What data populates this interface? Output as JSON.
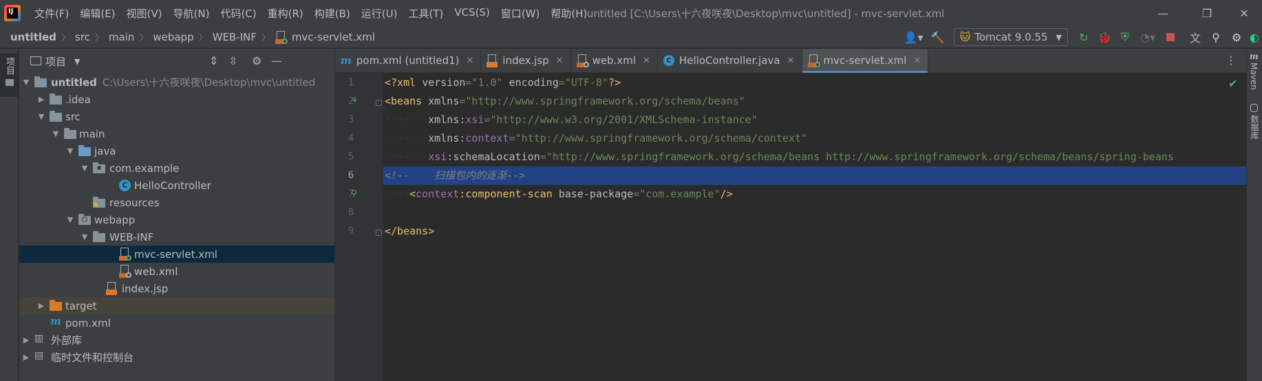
{
  "window": {
    "title": "untitled [C:\\Users\\十六夜咲夜\\Desktop\\mvc\\untitled] - mvc-servlet.xml",
    "minimize": "—",
    "restore": "❐",
    "close": "✕"
  },
  "menu": [
    "文件(F)",
    "编辑(E)",
    "视图(V)",
    "导航(N)",
    "代码(C)",
    "重构(R)",
    "构建(B)",
    "运行(U)",
    "工具(T)",
    "VCS(S)",
    "窗口(W)",
    "帮助(H)"
  ],
  "breadcrumb": [
    "untitled",
    "src",
    "main",
    "webapp",
    "WEB-INF",
    "mvc-servlet.xml"
  ],
  "toolbar": {
    "run_config": "Tomcat 9.0.55"
  },
  "left_strip": {
    "project_tab": "项目"
  },
  "project_panel": {
    "title": "项目",
    "tree": [
      {
        "label": "untitled",
        "path": "C:\\Users\\十六夜咲夜\\Desktop\\mvc\\untitled",
        "depth": 0,
        "expanded": true,
        "icon": "module-folder-icon"
      },
      {
        "label": ".idea",
        "depth": 1,
        "expanded": false,
        "icon": "folder-icon"
      },
      {
        "label": "src",
        "depth": 1,
        "expanded": true,
        "icon": "folder-icon"
      },
      {
        "label": "main",
        "depth": 2,
        "expanded": true,
        "icon": "folder-icon"
      },
      {
        "label": "java",
        "depth": 3,
        "expanded": true,
        "icon": "source-folder-icon"
      },
      {
        "label": "com.example",
        "depth": 4,
        "expanded": true,
        "icon": "package-icon"
      },
      {
        "label": "HelloController",
        "depth": 5,
        "icon": "class-icon"
      },
      {
        "label": "resources",
        "depth": 4,
        "icon": "resources-folder-icon"
      },
      {
        "label": "webapp",
        "depth": 3,
        "expanded": true,
        "icon": "web-folder-icon"
      },
      {
        "label": "WEB-INF",
        "depth": 4,
        "expanded": true,
        "icon": "folder-icon"
      },
      {
        "label": "mvc-servlet.xml",
        "depth": 5,
        "icon": "spring-xml-icon",
        "selected": true
      },
      {
        "label": "web.xml",
        "depth": 5,
        "icon": "web-xml-icon"
      },
      {
        "label": "index.jsp",
        "depth": 4,
        "icon": "jsp-icon"
      },
      {
        "label": "target",
        "depth": 1,
        "expanded": false,
        "icon": "excluded-folder-icon",
        "excluded": true
      },
      {
        "label": "pom.xml",
        "depth": 1,
        "icon": "maven-icon"
      },
      {
        "label": "外部库",
        "depth": 0,
        "expanded": false,
        "icon": "library-icon"
      },
      {
        "label": "临时文件和控制台",
        "depth": 0,
        "expanded": false,
        "icon": "scratch-icon"
      }
    ]
  },
  "tabs": [
    {
      "label": "pom.xml (untitled1)",
      "icon": "maven-icon"
    },
    {
      "label": "index.jsp",
      "icon": "jsp-icon"
    },
    {
      "label": "web.xml",
      "icon": "web-xml-icon"
    },
    {
      "label": "HelloController.java",
      "icon": "class-icon"
    },
    {
      "label": "mvc-servlet.xml",
      "icon": "spring-xml-icon",
      "active": true
    }
  ],
  "editor": {
    "current_line": 6,
    "lines": [
      {
        "no": "1",
        "text": "<?xml version=\"1.0\" encoding=\"UTF-8\"?>"
      },
      {
        "no": "2",
        "text": "<beans xmlns=\"http://www.springframework.org/schema/beans\""
      },
      {
        "no": "3",
        "text": "       xmlns:xsi=\"http://www.w3.org/2001/XMLSchema-instance\""
      },
      {
        "no": "4",
        "text": "       xmlns:context=\"http://www.springframework.org/schema/context\""
      },
      {
        "no": "5",
        "text": "       xsi:schemaLocation=\"http://www.springframework.org/schema/beans http://www.springframework.org/schema/beans/spring-beans"
      },
      {
        "no": "6",
        "text": "<!--    扫描包内的逐渐-->"
      },
      {
        "no": "7",
        "text": "    <context:component-scan base-package=\"com.example\"/>"
      },
      {
        "no": "8",
        "text": ""
      },
      {
        "no": "9",
        "text": "</beans>"
      }
    ]
  },
  "right_strip": {
    "maven": "Maven",
    "database": "数据库"
  },
  "colors": {
    "bg": "#2b2b2b",
    "panel": "#3c3f41",
    "selection": "#214283",
    "tab_accent": "#4a88c7",
    "tag": "#e8bf6a",
    "string": "#6a8759",
    "namespace": "#9876aa",
    "comment": "#808080"
  }
}
